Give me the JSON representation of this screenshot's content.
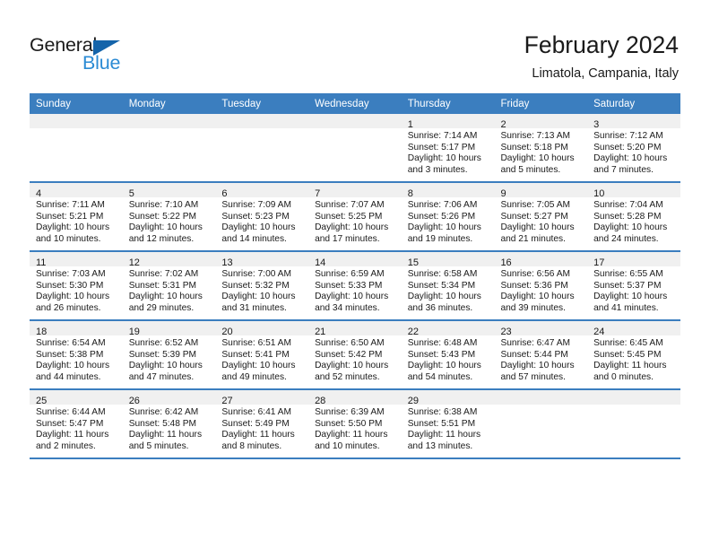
{
  "brand": {
    "name_part1": "General",
    "name_part2": "Blue",
    "color_dark": "#1a1a1a",
    "color_blue": "#2b8bd4",
    "triangle_color": "#1464aa"
  },
  "header": {
    "title": "February 2024",
    "subtitle": "Limatola, Campania, Italy"
  },
  "theme": {
    "header_bg": "#3b7ebf",
    "header_text": "#ffffff",
    "daynum_band_bg": "#f0f0f0",
    "row_separator": "#3b7ebf",
    "body_text": "#1a1a1a"
  },
  "weekdays": [
    "Sunday",
    "Monday",
    "Tuesday",
    "Wednesday",
    "Thursday",
    "Friday",
    "Saturday"
  ],
  "weeks": [
    [
      {
        "empty": true
      },
      {
        "empty": true
      },
      {
        "empty": true
      },
      {
        "empty": true
      },
      {
        "day": "1",
        "sunrise": "Sunrise: 7:14 AM",
        "sunset": "Sunset: 5:17 PM",
        "daylight1": "Daylight: 10 hours",
        "daylight2": "and 3 minutes."
      },
      {
        "day": "2",
        "sunrise": "Sunrise: 7:13 AM",
        "sunset": "Sunset: 5:18 PM",
        "daylight1": "Daylight: 10 hours",
        "daylight2": "and 5 minutes."
      },
      {
        "day": "3",
        "sunrise": "Sunrise: 7:12 AM",
        "sunset": "Sunset: 5:20 PM",
        "daylight1": "Daylight: 10 hours",
        "daylight2": "and 7 minutes."
      }
    ],
    [
      {
        "day": "4",
        "sunrise": "Sunrise: 7:11 AM",
        "sunset": "Sunset: 5:21 PM",
        "daylight1": "Daylight: 10 hours",
        "daylight2": "and 10 minutes."
      },
      {
        "day": "5",
        "sunrise": "Sunrise: 7:10 AM",
        "sunset": "Sunset: 5:22 PM",
        "daylight1": "Daylight: 10 hours",
        "daylight2": "and 12 minutes."
      },
      {
        "day": "6",
        "sunrise": "Sunrise: 7:09 AM",
        "sunset": "Sunset: 5:23 PM",
        "daylight1": "Daylight: 10 hours",
        "daylight2": "and 14 minutes."
      },
      {
        "day": "7",
        "sunrise": "Sunrise: 7:07 AM",
        "sunset": "Sunset: 5:25 PM",
        "daylight1": "Daylight: 10 hours",
        "daylight2": "and 17 minutes."
      },
      {
        "day": "8",
        "sunrise": "Sunrise: 7:06 AM",
        "sunset": "Sunset: 5:26 PM",
        "daylight1": "Daylight: 10 hours",
        "daylight2": "and 19 minutes."
      },
      {
        "day": "9",
        "sunrise": "Sunrise: 7:05 AM",
        "sunset": "Sunset: 5:27 PM",
        "daylight1": "Daylight: 10 hours",
        "daylight2": "and 21 minutes."
      },
      {
        "day": "10",
        "sunrise": "Sunrise: 7:04 AM",
        "sunset": "Sunset: 5:28 PM",
        "daylight1": "Daylight: 10 hours",
        "daylight2": "and 24 minutes."
      }
    ],
    [
      {
        "day": "11",
        "sunrise": "Sunrise: 7:03 AM",
        "sunset": "Sunset: 5:30 PM",
        "daylight1": "Daylight: 10 hours",
        "daylight2": "and 26 minutes."
      },
      {
        "day": "12",
        "sunrise": "Sunrise: 7:02 AM",
        "sunset": "Sunset: 5:31 PM",
        "daylight1": "Daylight: 10 hours",
        "daylight2": "and 29 minutes."
      },
      {
        "day": "13",
        "sunrise": "Sunrise: 7:00 AM",
        "sunset": "Sunset: 5:32 PM",
        "daylight1": "Daylight: 10 hours",
        "daylight2": "and 31 minutes."
      },
      {
        "day": "14",
        "sunrise": "Sunrise: 6:59 AM",
        "sunset": "Sunset: 5:33 PM",
        "daylight1": "Daylight: 10 hours",
        "daylight2": "and 34 minutes."
      },
      {
        "day": "15",
        "sunrise": "Sunrise: 6:58 AM",
        "sunset": "Sunset: 5:34 PM",
        "daylight1": "Daylight: 10 hours",
        "daylight2": "and 36 minutes."
      },
      {
        "day": "16",
        "sunrise": "Sunrise: 6:56 AM",
        "sunset": "Sunset: 5:36 PM",
        "daylight1": "Daylight: 10 hours",
        "daylight2": "and 39 minutes."
      },
      {
        "day": "17",
        "sunrise": "Sunrise: 6:55 AM",
        "sunset": "Sunset: 5:37 PM",
        "daylight1": "Daylight: 10 hours",
        "daylight2": "and 41 minutes."
      }
    ],
    [
      {
        "day": "18",
        "sunrise": "Sunrise: 6:54 AM",
        "sunset": "Sunset: 5:38 PM",
        "daylight1": "Daylight: 10 hours",
        "daylight2": "and 44 minutes."
      },
      {
        "day": "19",
        "sunrise": "Sunrise: 6:52 AM",
        "sunset": "Sunset: 5:39 PM",
        "daylight1": "Daylight: 10 hours",
        "daylight2": "and 47 minutes."
      },
      {
        "day": "20",
        "sunrise": "Sunrise: 6:51 AM",
        "sunset": "Sunset: 5:41 PM",
        "daylight1": "Daylight: 10 hours",
        "daylight2": "and 49 minutes."
      },
      {
        "day": "21",
        "sunrise": "Sunrise: 6:50 AM",
        "sunset": "Sunset: 5:42 PM",
        "daylight1": "Daylight: 10 hours",
        "daylight2": "and 52 minutes."
      },
      {
        "day": "22",
        "sunrise": "Sunrise: 6:48 AM",
        "sunset": "Sunset: 5:43 PM",
        "daylight1": "Daylight: 10 hours",
        "daylight2": "and 54 minutes."
      },
      {
        "day": "23",
        "sunrise": "Sunrise: 6:47 AM",
        "sunset": "Sunset: 5:44 PM",
        "daylight1": "Daylight: 10 hours",
        "daylight2": "and 57 minutes."
      },
      {
        "day": "24",
        "sunrise": "Sunrise: 6:45 AM",
        "sunset": "Sunset: 5:45 PM",
        "daylight1": "Daylight: 11 hours",
        "daylight2": "and 0 minutes."
      }
    ],
    [
      {
        "day": "25",
        "sunrise": "Sunrise: 6:44 AM",
        "sunset": "Sunset: 5:47 PM",
        "daylight1": "Daylight: 11 hours",
        "daylight2": "and 2 minutes."
      },
      {
        "day": "26",
        "sunrise": "Sunrise: 6:42 AM",
        "sunset": "Sunset: 5:48 PM",
        "daylight1": "Daylight: 11 hours",
        "daylight2": "and 5 minutes."
      },
      {
        "day": "27",
        "sunrise": "Sunrise: 6:41 AM",
        "sunset": "Sunset: 5:49 PM",
        "daylight1": "Daylight: 11 hours",
        "daylight2": "and 8 minutes."
      },
      {
        "day": "28",
        "sunrise": "Sunrise: 6:39 AM",
        "sunset": "Sunset: 5:50 PM",
        "daylight1": "Daylight: 11 hours",
        "daylight2": "and 10 minutes."
      },
      {
        "day": "29",
        "sunrise": "Sunrise: 6:38 AM",
        "sunset": "Sunset: 5:51 PM",
        "daylight1": "Daylight: 11 hours",
        "daylight2": "and 13 minutes."
      },
      {
        "empty": true
      },
      {
        "empty": true
      }
    ]
  ]
}
